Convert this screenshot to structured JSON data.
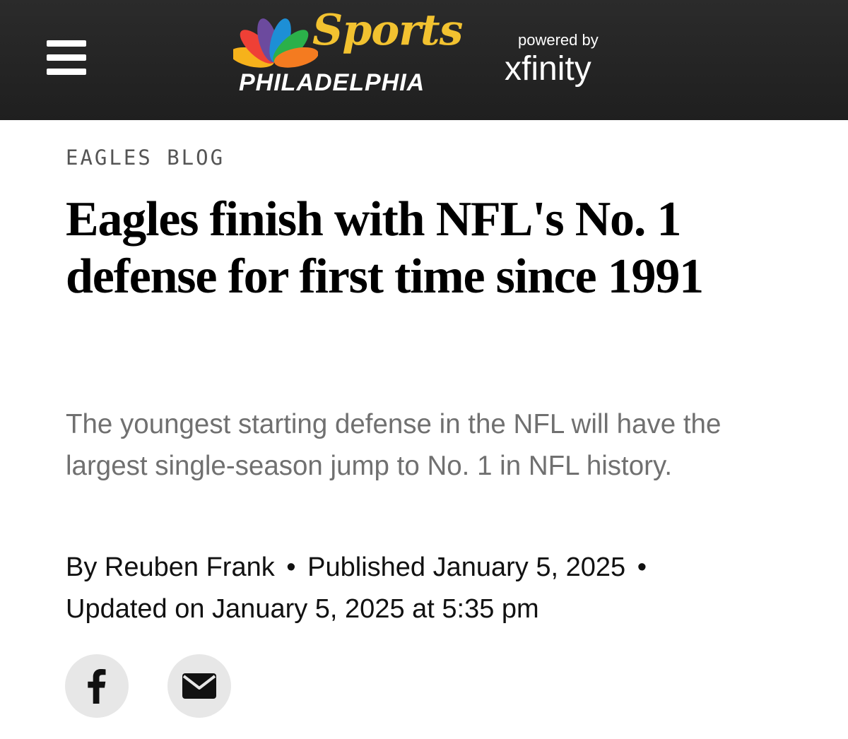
{
  "header": {
    "logo_sports": "Sports",
    "logo_city": "PHILADELPHIA",
    "powered_by": "powered by",
    "partner": "xfinity",
    "peacock_colors": [
      "#f6b21b",
      "#ef4036",
      "#6c4a9e",
      "#1d8fd6",
      "#2bb04a",
      "#f47b20"
    ]
  },
  "article": {
    "category": "EAGLES BLOG",
    "headline": "Eagles finish with NFL's No. 1 defense for first time since 1991",
    "subheadline": "The youngest starting defense in the NFL will have the largest single-season jump to No. 1 in NFL history.",
    "byline": {
      "prefix": "By ",
      "author": "Reuben Frank",
      "separator": "•",
      "published": "Published January 5, 2025",
      "updated": "Updated on January 5, 2025 at 5:35 pm"
    },
    "share": {
      "facebook_icon": "facebook-icon",
      "email_icon": "envelope-icon"
    }
  },
  "colors": {
    "header_bg": "#222222",
    "logo_gold": "#f2c230",
    "category_text": "#555555",
    "subhead_text": "#707070",
    "share_button_bg": "#e7e7e7"
  }
}
